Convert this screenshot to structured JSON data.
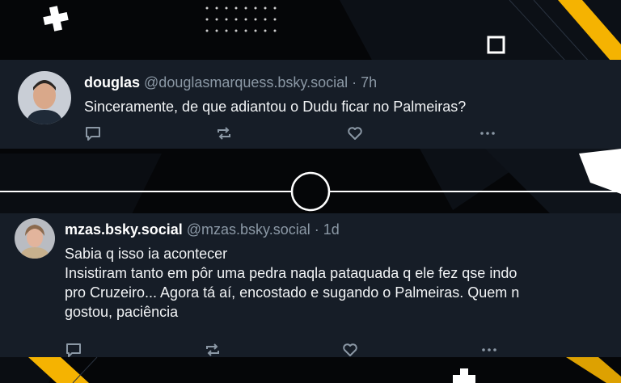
{
  "posts": [
    {
      "display_name": "douglas",
      "handle": "@douglasmarquess.bsky.social",
      "separator": " · ",
      "time": "7h",
      "lines": [
        "Sinceramente, de que adiantou o Dudu ficar no Palmeiras?"
      ]
    },
    {
      "display_name": "mzas.bsky.social",
      "handle": "@mzas.bsky.social",
      "separator": " · ",
      "time": "1d",
      "lines": [
        "Sabia q isso ia acontecer",
        "Insistiram tanto em pôr uma pedra naqla pataquada q ele fez qse indo",
        "pro Cruzeiro... Agora tá aí, encostado e sugando o Palmeiras. Quem n",
        "gostou, paciência"
      ]
    }
  ],
  "icons": [
    "reply-icon",
    "repost-icon",
    "like-icon",
    "more-icon",
    "plus-icon",
    "square-icon",
    "circle-icon"
  ],
  "colors": {
    "background": "#050608",
    "card": "#161d27",
    "text": "#f1f3f5",
    "muted": "#8b98a5",
    "accent": "#f5b301"
  }
}
